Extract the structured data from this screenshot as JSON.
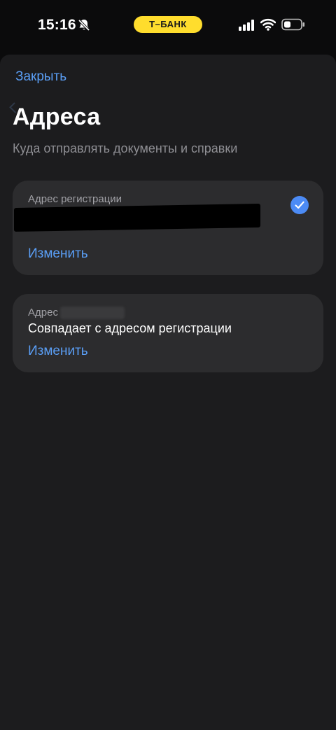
{
  "status_bar": {
    "time": "15:16",
    "bank_badge": "Т–БАНК",
    "icons": [
      "bell-slash-icon",
      "signal-icon",
      "wifi-icon",
      "battery-icon"
    ]
  },
  "sheet": {
    "close_label": "Закрыть",
    "title": "Адреса",
    "subtitle": "Куда отправлять документы и справки"
  },
  "addresses": [
    {
      "label": "Адрес регистрации",
      "value": "",
      "selected": true,
      "action_label": "Изменить"
    },
    {
      "label": "Адрес",
      "value": "Совпадает с адресом регистрации",
      "selected": false,
      "action_label": "Изменить"
    }
  ],
  "colors": {
    "accent": "#5a9ef5",
    "brand_yellow": "#ffdd2d",
    "sheet_bg": "#1c1c1e",
    "card_bg": "#2c2c2e",
    "check_bg": "#4c8bf5"
  }
}
